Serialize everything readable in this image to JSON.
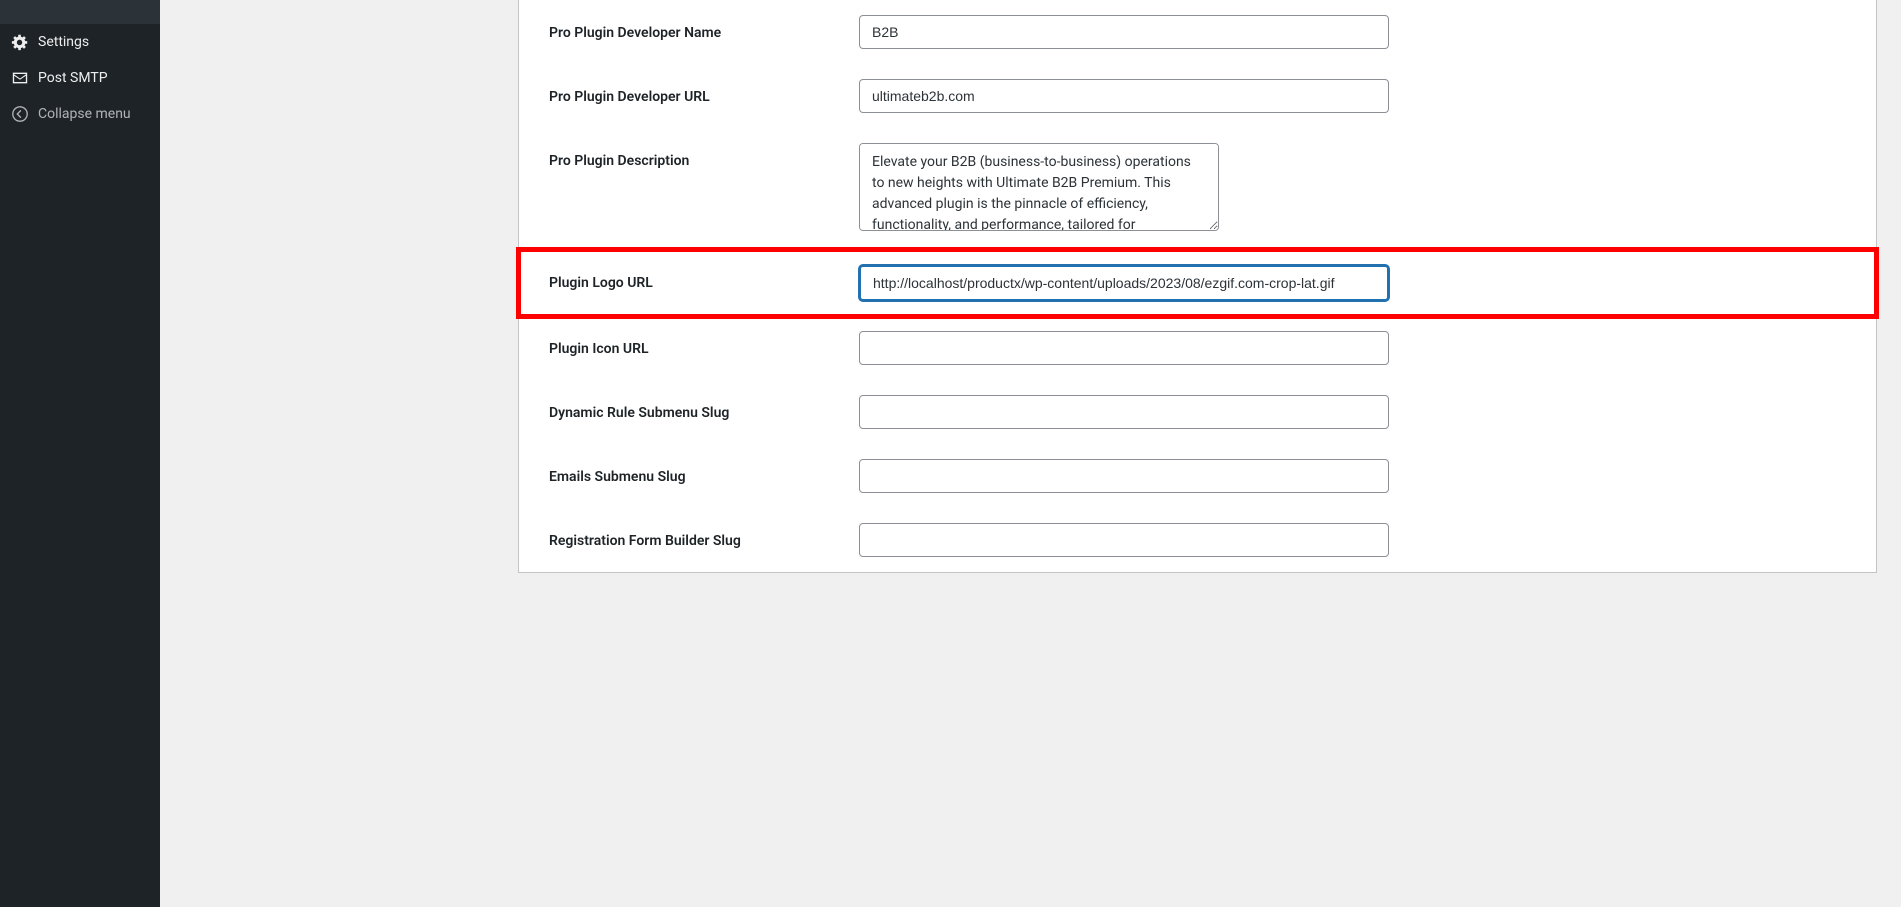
{
  "sidebar": {
    "topItem": "",
    "settings": "Settings",
    "postSmtp": "Post SMTP",
    "collapse": "Collapse menu"
  },
  "form": {
    "devNameLabel": "Pro Plugin Developer Name",
    "devNameValue": "B2B",
    "devUrlLabel": "Pro Plugin Developer URL",
    "devUrlValue": "ultimateb2b.com",
    "descLabel": "Pro Plugin Description",
    "descValue": "Elevate your B2B (business-to-business) operations to new heights with Ultimate B2B Premium. This advanced plugin is the pinnacle of efficiency, functionality, and performance, tailored for",
    "logoUrlLabel": "Plugin Logo URL",
    "logoUrlValue": "http://localhost/productx/wp-content/uploads/2023/08/ezgif.com-crop-lat.gif",
    "iconUrlLabel": "Plugin Icon URL",
    "iconUrlValue": "",
    "ruleSlugLabel": "Dynamic Rule Submenu Slug",
    "ruleSlugValue": "",
    "emailsSlugLabel": "Emails Submenu Slug",
    "emailsSlugValue": "",
    "regFormLabel": "Registration Form Builder Slug",
    "regFormValue": ""
  }
}
